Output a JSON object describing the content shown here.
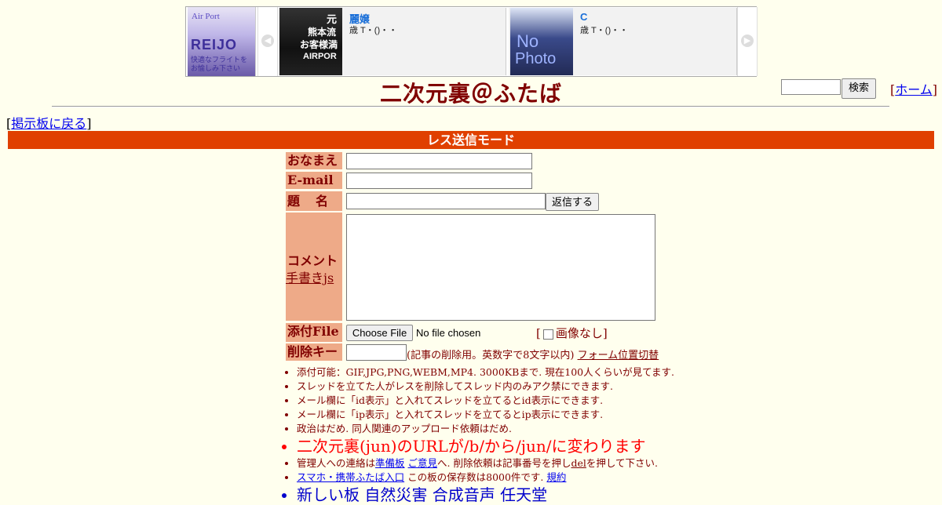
{
  "banner": {
    "left_thumb": {
      "brand": "Air Port",
      "logo": "REIJO",
      "sub": "快適なフライトを お愉しみ下さい"
    },
    "prev_icon": "chevron-left-icon",
    "next_icon": "chevron-right-icon",
    "cards": [
      {
        "thumb_text": "元\n熊本流\nお客様満\nAIRPOR",
        "name": "麗嬢",
        "meta": "歳 T・()・・"
      },
      {
        "thumb_text": "No Photo",
        "name": "C",
        "meta": "歳 T・()・・"
      }
    ]
  },
  "header": {
    "title": "二次元裏＠ふたば",
    "search_button": "検索",
    "home_link": "ホーム",
    "back_link": "掲示板に戻る"
  },
  "mode_bar": "レス送信モード",
  "form": {
    "name_label": "おなまえ",
    "email_label": "E-mail",
    "subject_label": "題　名",
    "reply_button": "返信する",
    "comment_label": "コメント",
    "handwrite_link": "手書きjs",
    "file_label": "添付File",
    "file_button": "Choose File",
    "file_status": "No file chosen",
    "noimage_label": "画像なし",
    "delkey_label": "削除キー",
    "delkey_note": "(記事の削除用。英数字で8文字以内)",
    "form_toggle": "フォーム位置切替"
  },
  "notes": {
    "n1": "添付可能：GIF,JPG,PNG,WEBM,MP4. 3000KBまで. 現在100人くらいが見てます.",
    "n2": "スレッドを立てた人がレスを削除してスレッド内のみアク禁にできます.",
    "n3": "メール欄に「id表示」と入れてスレッドを立てるとid表示にできます.",
    "n4": "メール欄に「ip表示」と入れてスレッドを立てるとip表示にできます.",
    "n5": "政治はだめ. 同人関連のアップロード依頼はだめ.",
    "n6": "二次元裏(jun)のURLが/b/から/jun/に変わります",
    "n7_a": "管理人への連絡は",
    "n7_link1": "準備板",
    "n7_link2": "ご意見",
    "n7_b": "へ. 削除依頼は記事番号を押し",
    "n7_link3": "del",
    "n7_c": "を押して下さい.",
    "n8_link": "スマホ・携帯ふたば入口",
    "n8_text": " この板の保存数は8000件です.",
    "n8_link2": "規約",
    "n9": "新しい板 自然災害 合成音声 任天堂"
  }
}
